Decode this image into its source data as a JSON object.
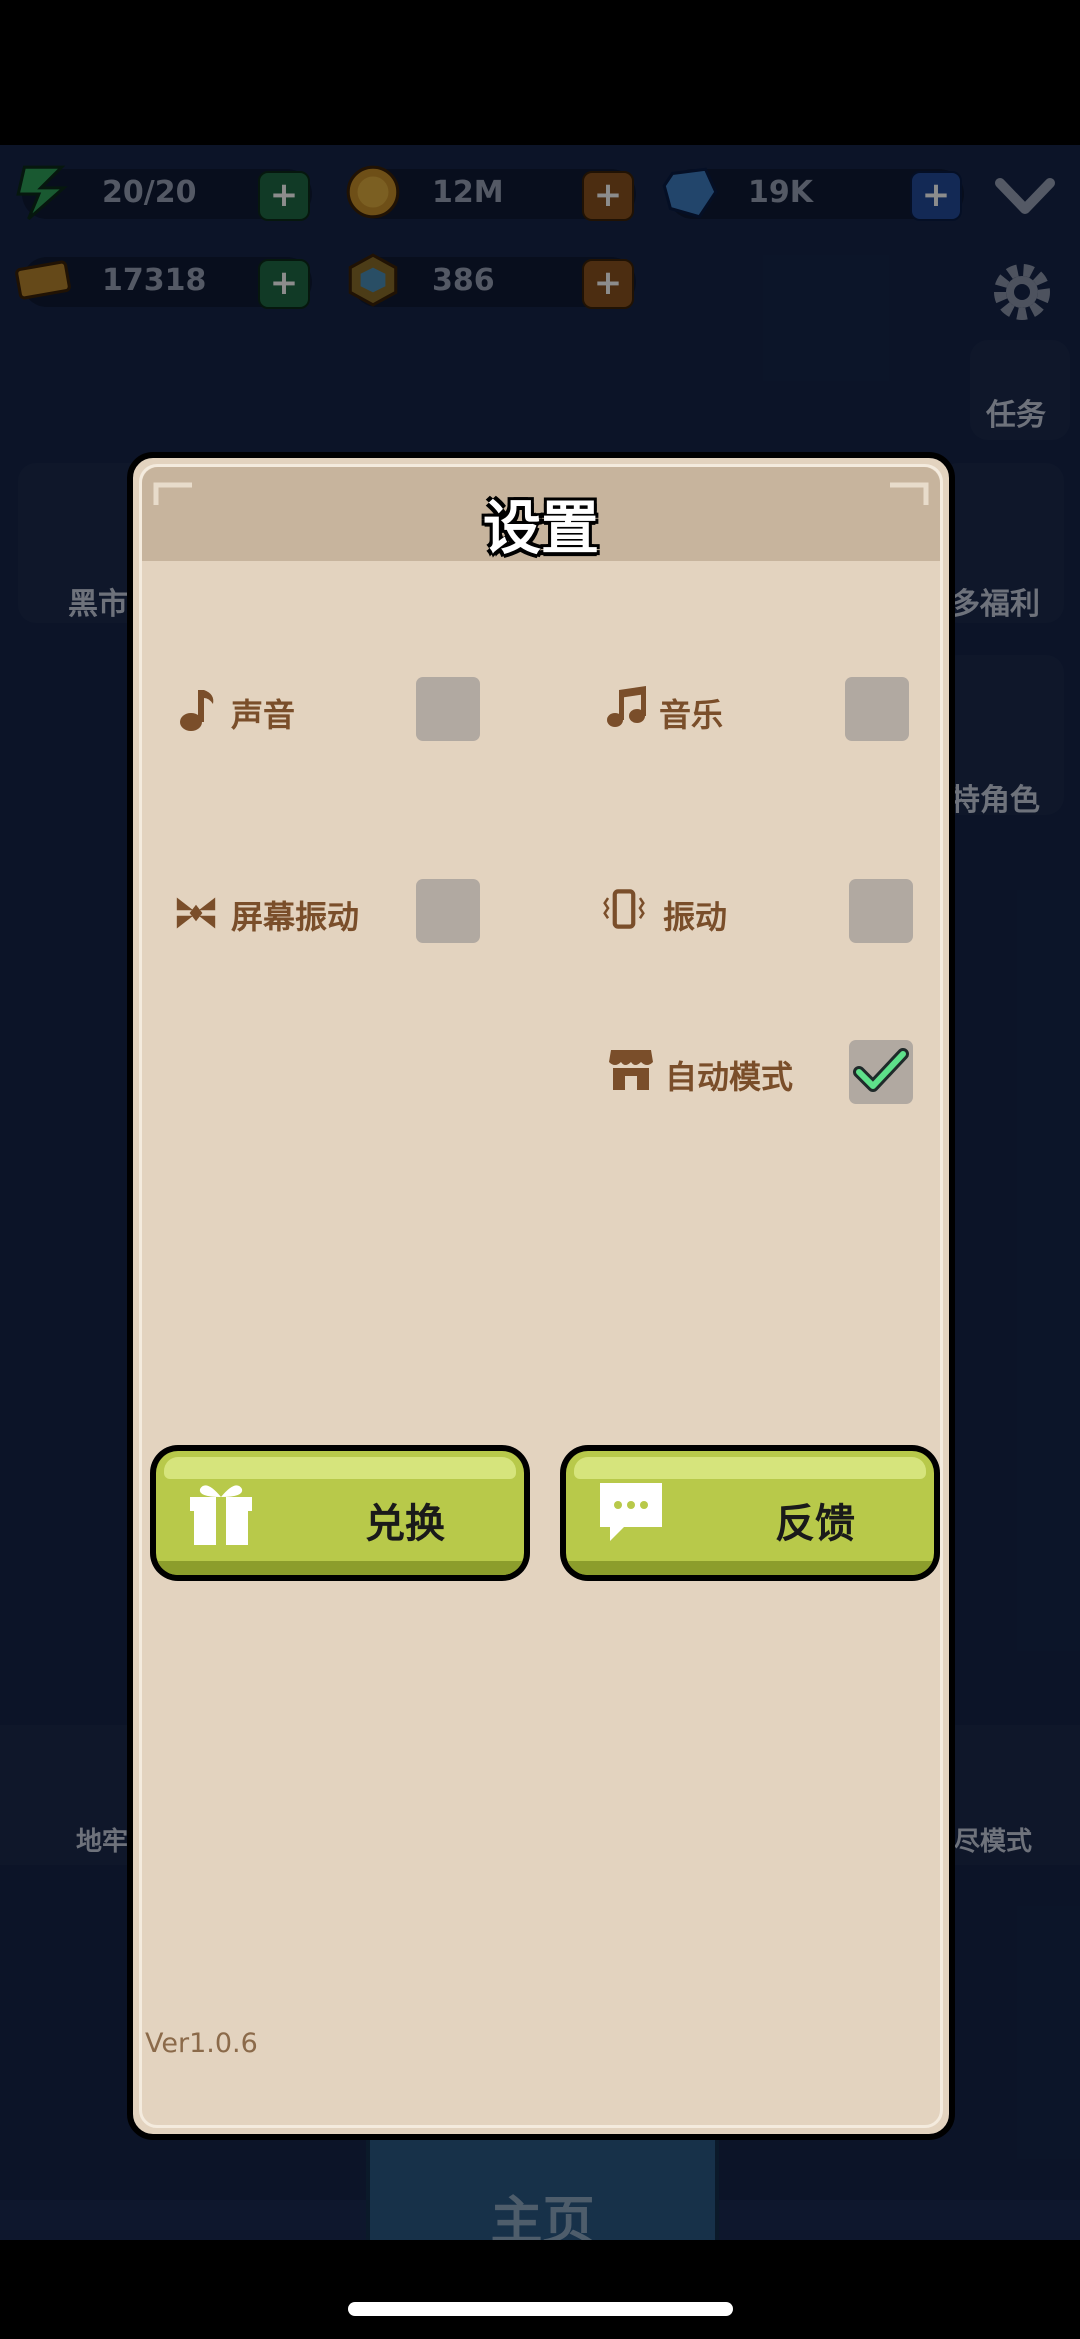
{
  "resources": {
    "energy": "20/20",
    "coins": "12M",
    "gems": "19K",
    "tickets": "17318",
    "hex": "386"
  },
  "side_menu": {
    "tasks": "任务",
    "black_market": "黑市",
    "welfare": "多福利",
    "character": "特角色",
    "dungeon": "地牢",
    "endless": "尽模式"
  },
  "bottom_nav": {
    "home": "主页"
  },
  "settings": {
    "title": "设置",
    "options": {
      "sound": {
        "label": "声音",
        "checked": false
      },
      "music": {
        "label": "音乐",
        "checked": false
      },
      "screen_shake": {
        "label": "屏幕振动",
        "checked": false
      },
      "vibration": {
        "label": "振动",
        "checked": false
      },
      "auto_mode": {
        "label": "自动模式",
        "checked": true
      }
    },
    "redeem_label": "兑换",
    "feedback_label": "反馈",
    "version": "Ver1.0.6"
  },
  "colors": {
    "panel_bg": "#e3d3bf",
    "header_bg": "#c7b49d",
    "label_brown": "#7a4e2a",
    "button_green": "#b8c94a",
    "check_green": "#5ee08a"
  }
}
